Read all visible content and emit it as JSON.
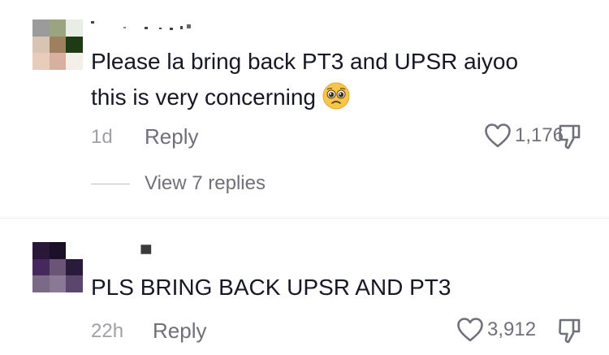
{
  "comments": [
    {
      "text_line1": "Please la bring back PT3 and UPSR aiyoo",
      "text_line2": "this is very concerning",
      "emoji": "pleading-face",
      "time": "1d",
      "reply_label": "Reply",
      "likes": "1,176",
      "view_replies": "View 7 replies"
    },
    {
      "text": "PLS BRING BACK UPSR AND PT3",
      "time": "22h",
      "reply_label": "Reply",
      "likes": "3,912"
    }
  ],
  "colors": {
    "text": "#161823",
    "muted": "#6f707a",
    "time": "#a0a0a6"
  }
}
